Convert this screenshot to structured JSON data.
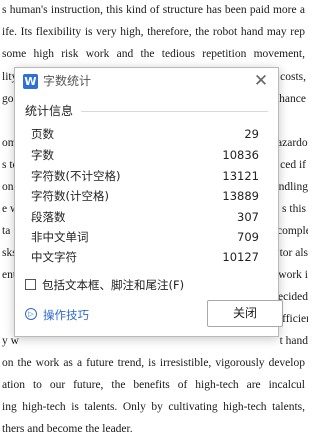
{
  "document": {
    "lines": [
      "s human's instruction, this kind of structure has been paid more a",
      "ife. Its flexibility is very high, therefore, the robot hand may rep",
      " some high risk work and the tedious repetition movement,",
      "lity",
      "goo",
      "",
      "ome",
      "s to",
      "ona",
      "e w",
      "ta",
      "sks",
      "ent",
      "",
      "",
      "y w",
      "on the work as a future trend, is irresistible, vigorously develop",
      "ation to our future, the benefits of high-tech are incalcul",
      "ing high-tech is talents. Only by cultivating high-tech talents,",
      "thers and become the leader."
    ],
    "right_fragments": [
      "costs,",
      "hance",
      "azardou",
      "ced if",
      "ndling",
      "s this",
      "comple",
      "tor als",
      "work i",
      "ecided",
      "efficien",
      "t hand"
    ]
  },
  "dialog": {
    "title": "字数统计",
    "app_icon_letter": "W",
    "close_glyph": "✕",
    "section_title": "统计信息",
    "stats": [
      {
        "label": "页数",
        "value": "29"
      },
      {
        "label": "字数",
        "value": "10836"
      },
      {
        "label": "字符数(不计空格)",
        "value": "13121"
      },
      {
        "label": "字符数(计空格)",
        "value": "13889"
      },
      {
        "label": "段落数",
        "value": "307"
      },
      {
        "label": "非中文单词",
        "value": "709"
      },
      {
        "label": "中文字符",
        "value": "10127"
      }
    ],
    "checkbox_label": "包括文本框、脚注和尾注(F)",
    "checkbox_checked": false,
    "tips_link": "操作技巧",
    "tips_icon": "▷",
    "close_button": "关闭",
    "accent_color": "#2e6bd0"
  }
}
